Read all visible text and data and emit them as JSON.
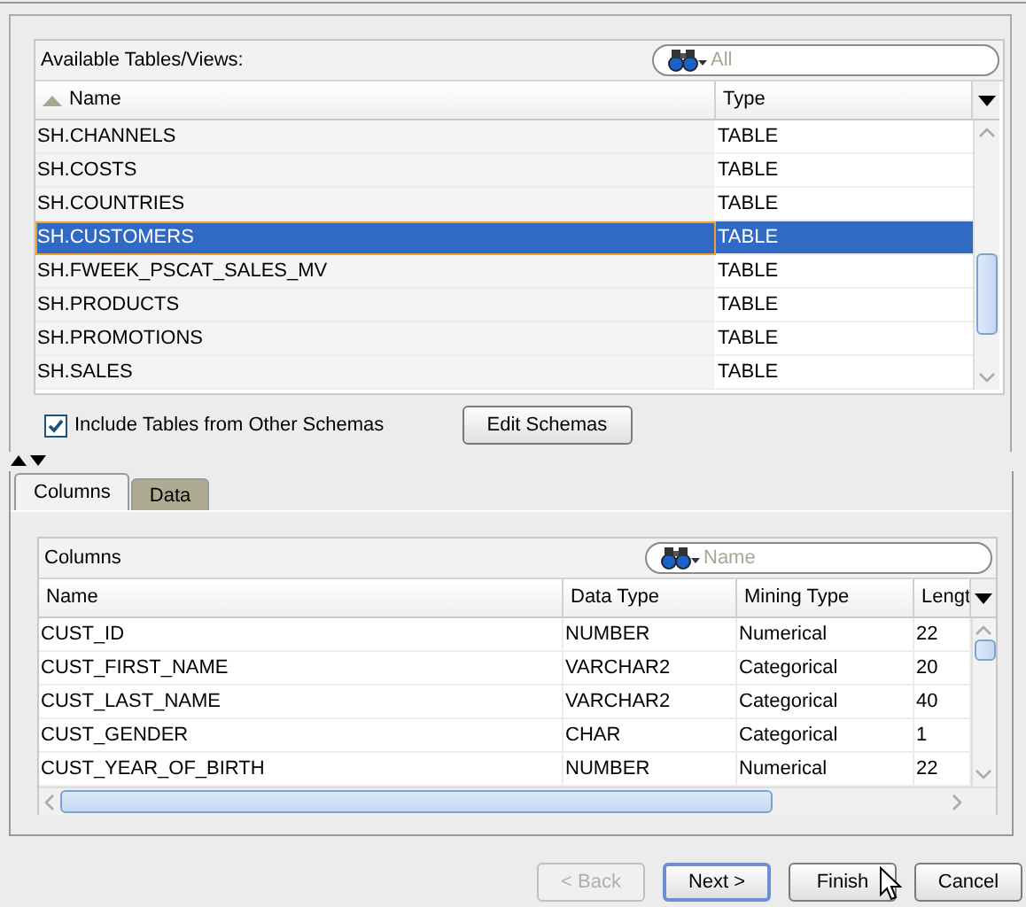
{
  "tables_panel": {
    "label": "Available Tables/Views:",
    "search": {
      "placeholder": "All"
    },
    "columns": [
      {
        "label": "Name",
        "sorted": true
      },
      {
        "label": "Type",
        "sorted": false
      }
    ],
    "rows": [
      {
        "name": "SH.CHANNELS",
        "type": "TABLE",
        "selected": false
      },
      {
        "name": "SH.COSTS",
        "type": "TABLE",
        "selected": false
      },
      {
        "name": "SH.COUNTRIES",
        "type": "TABLE",
        "selected": false
      },
      {
        "name": "SH.CUSTOMERS",
        "type": "TABLE",
        "selected": true
      },
      {
        "name": "SH.FWEEK_PSCAT_SALES_MV",
        "type": "TABLE",
        "selected": false
      },
      {
        "name": "SH.PRODUCTS",
        "type": "TABLE",
        "selected": false
      },
      {
        "name": "SH.PROMOTIONS",
        "type": "TABLE",
        "selected": false
      },
      {
        "name": "SH.SALES",
        "type": "TABLE",
        "selected": false
      }
    ],
    "include_other_schemas": {
      "label": "Include Tables from Other Schemas",
      "checked": true
    },
    "edit_button": "Edit Schemas"
  },
  "tabs": [
    {
      "label": "Columns",
      "selected": true
    },
    {
      "label": "Data",
      "selected": false
    }
  ],
  "columns_panel": {
    "label": "Columns",
    "search": {
      "placeholder": "Name"
    },
    "columns": [
      "Name",
      "Data Type",
      "Mining Type",
      "Lengt"
    ],
    "rows": [
      [
        "CUST_ID",
        "NUMBER",
        "Numerical",
        "22"
      ],
      [
        "CUST_FIRST_NAME",
        "VARCHAR2",
        "Categorical",
        "20"
      ],
      [
        "CUST_LAST_NAME",
        "VARCHAR2",
        "Categorical",
        "40"
      ],
      [
        "CUST_GENDER",
        "CHAR",
        "Categorical",
        "1"
      ],
      [
        "CUST_YEAR_OF_BIRTH",
        "NUMBER",
        "Numerical",
        "22"
      ]
    ]
  },
  "buttons": [
    {
      "label": "< Back",
      "disabled": true,
      "default": false
    },
    {
      "label": "Next >",
      "disabled": false,
      "default": true
    },
    {
      "label": "Finish",
      "disabled": false,
      "default": false
    },
    {
      "label": "Cancel",
      "disabled": false,
      "default": false
    }
  ]
}
